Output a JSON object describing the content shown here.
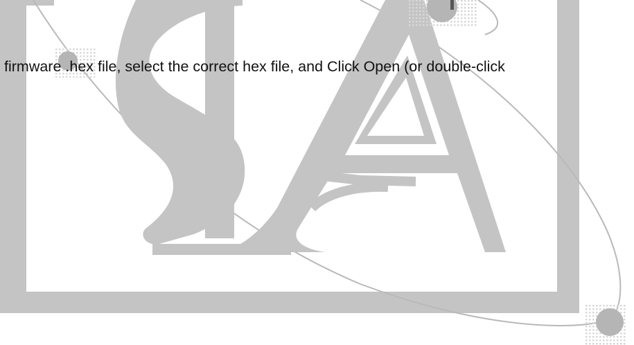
{
  "document": {
    "body_text": "firmware .hex file, select the correct hex file, and Click Open (or double-click"
  },
  "watermark": {
    "description_icon": "sla-logo-watermark",
    "fill_color": "#c4c4c4",
    "line_color": "#b9b9b9",
    "dot_color": "#b5b5b5",
    "dot_pattern_color": "#d8d8d8"
  }
}
